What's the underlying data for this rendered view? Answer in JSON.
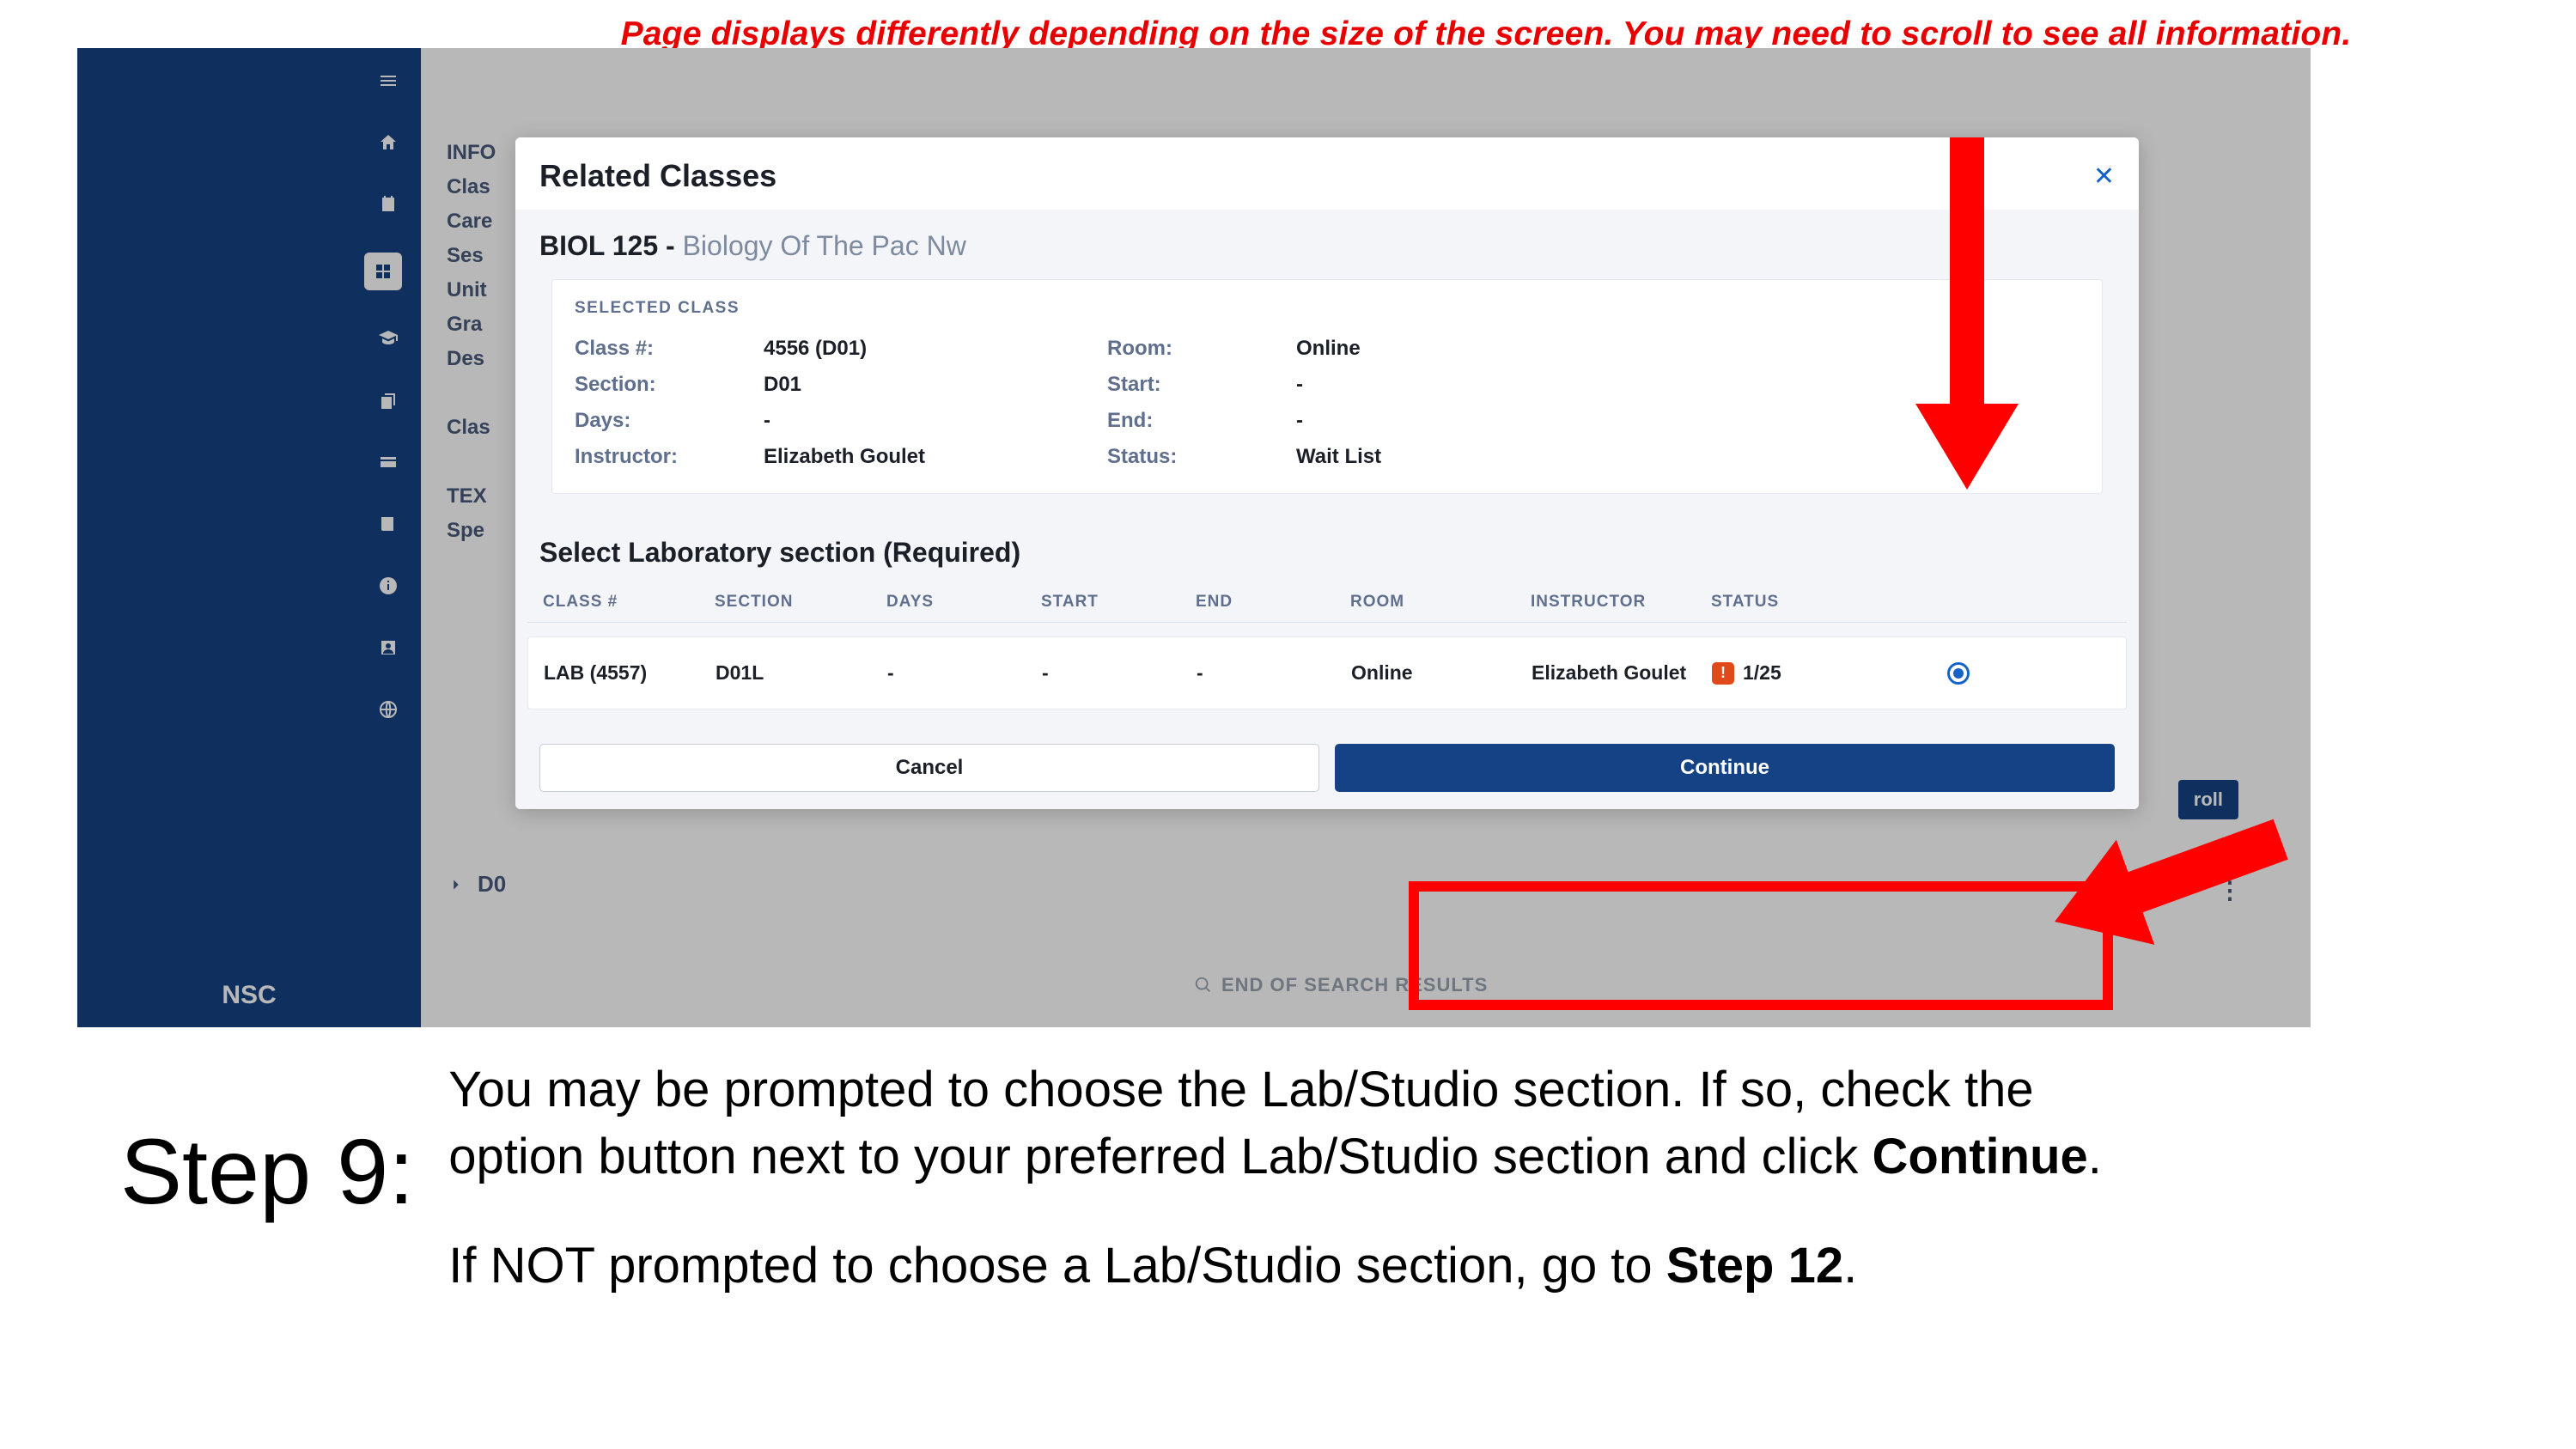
{
  "banner": "Page displays differently depending on the size of the screen. You may need to scroll to see all information.",
  "sidebar": {
    "icons": [
      "menu",
      "home",
      "calendar",
      "grid",
      "grad",
      "copy",
      "card",
      "book",
      "info",
      "user",
      "globe"
    ],
    "brand": "NSC"
  },
  "bg_info_labels": [
    "INFO",
    "Clas",
    "Care",
    "Ses",
    "Unit",
    "Gra",
    "Des",
    "",
    "Clas",
    "",
    "TEX",
    "Spe"
  ],
  "bg_enroll": "roll",
  "bg_row2": "D0",
  "eos": "END OF SEARCH RESULTS",
  "modal": {
    "title": "Related Classes",
    "course_code": "BIOL 125 - ",
    "course_name": "Biology Of The Pac Nw",
    "selected_label": "SELECTED CLASS",
    "kv": [
      {
        "k": "Class #:",
        "v": "4556 (D01)"
      },
      {
        "k": "Room:",
        "v": "Online"
      },
      {
        "k": "Section:",
        "v": "D01"
      },
      {
        "k": "Start:",
        "v": "-"
      },
      {
        "k": "Days:",
        "v": "-"
      },
      {
        "k": "End:",
        "v": "-"
      },
      {
        "k": "Instructor:",
        "v": "Elizabeth Goulet"
      },
      {
        "k": "Status:",
        "v": "Wait List"
      }
    ],
    "lab_title": "Select Laboratory section (Required)",
    "lab_headers": [
      "CLASS #",
      "SECTION",
      "DAYS",
      "START",
      "END",
      "ROOM",
      "INSTRUCTOR",
      "STATUS",
      ""
    ],
    "lab_row": {
      "classnum": "LAB (4557)",
      "section": "D01L",
      "days": "-",
      "start": "-",
      "end": "-",
      "room": "Online",
      "instructor": "Elizabeth Goulet",
      "status_count": "1/25"
    },
    "cancel": "Cancel",
    "continue": "Continue"
  },
  "step": {
    "label": "Step 9:",
    "p1a": "You may be prompted to choose the Lab/Studio section. If so, check the option button next to your preferred Lab/Studio section and click ",
    "p1b": "Continue",
    "p1c": ".",
    "p2a": "If NOT prompted to choose a Lab/Studio section, go to ",
    "p2b": "Step 12",
    "p2c": "."
  }
}
